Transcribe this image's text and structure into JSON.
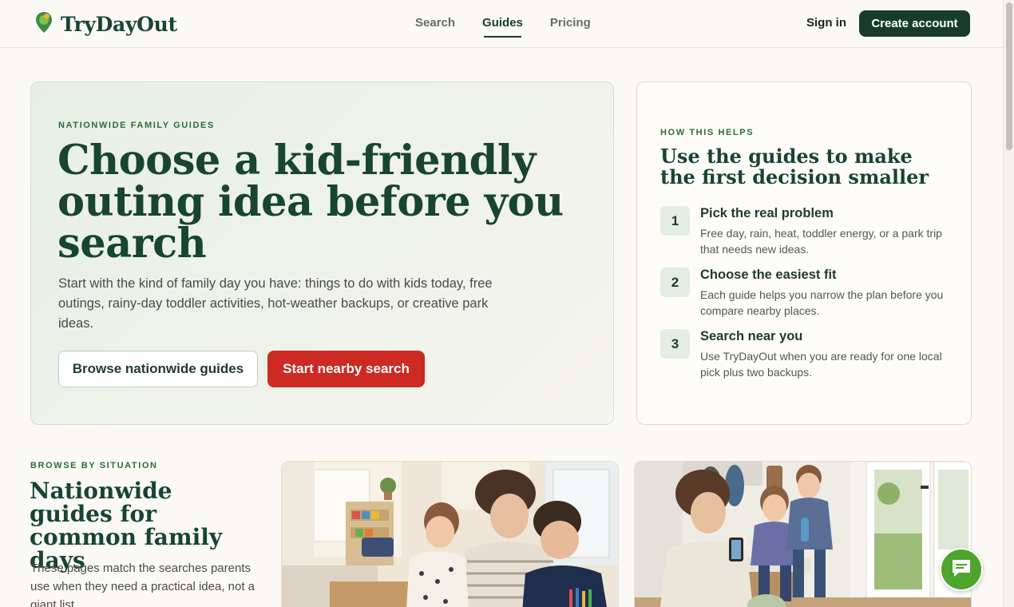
{
  "header": {
    "brand": "TryDayOut",
    "nav": [
      {
        "label": "Search",
        "active": false
      },
      {
        "label": "Guides",
        "active": true
      },
      {
        "label": "Pricing",
        "active": false
      }
    ],
    "sign_in": "Sign in",
    "create_account": "Create account"
  },
  "hero": {
    "eyebrow": "NATIONWIDE FAMILY GUIDES",
    "title": "Choose a kid-friendly outing idea before you search",
    "text": "Start with the kind of family day you have: things to do with kids today, free outings, rainy-day toddler activities, hot-weather backups, or creative park ideas.",
    "primary_button": "Browse nationwide guides",
    "secondary_button": "Start nearby search"
  },
  "how": {
    "eyebrow": "HOW THIS HELPS",
    "title": "Use the guides to make the first decision smaller",
    "steps": [
      {
        "num": "1",
        "title": "Pick the real problem",
        "text": "Free day, rain, heat, toddler energy, or a park trip that needs new ideas."
      },
      {
        "num": "2",
        "title": "Choose the easiest fit",
        "text": "Each guide helps you narrow the plan before you compare nearby places."
      },
      {
        "num": "3",
        "title": "Search near you",
        "text": "Use TryDayOut when you are ready for one local pick plus two backups."
      }
    ]
  },
  "browse": {
    "eyebrow": "BROWSE BY SITUATION",
    "title": "Nationwide guides for common family days",
    "text": "These pages match the searches parents use when they need a practical idea, not a giant list."
  },
  "colors": {
    "brand_green": "#18452f",
    "accent_red": "#cc2a22",
    "chat_green": "#4da52e"
  }
}
